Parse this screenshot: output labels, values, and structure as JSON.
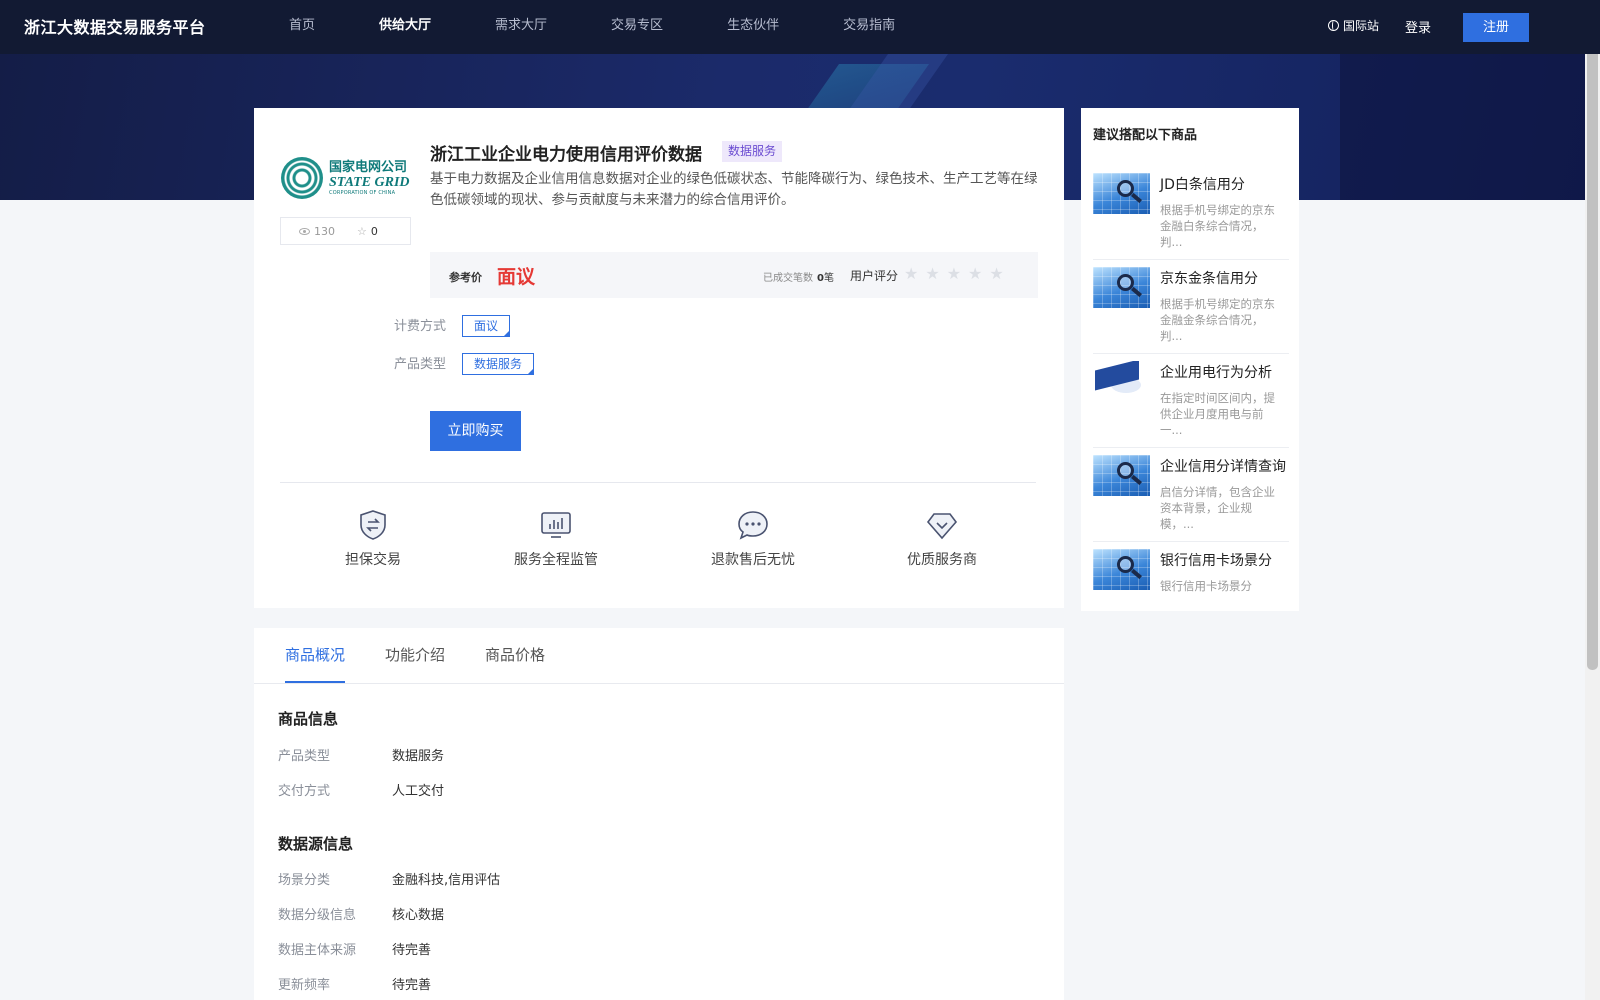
{
  "header": {
    "logo_text": "浙江大数据交易服务平台",
    "nav": [
      "首页",
      "供给大厅",
      "需求大厅",
      "交易专区",
      "生态伙伴",
      "交易指南"
    ],
    "active_nav_index": 1,
    "intl_label": "国际站",
    "login_label": "登录",
    "register_label": "注册"
  },
  "product": {
    "vendor_logo_cn": "国家电网公司",
    "vendor_logo_en": "STATE GRID",
    "vendor_logo_en_sub": "CORPORATION OF CHINA",
    "views": "130",
    "favorites": "0",
    "title": "浙江工业企业电力使用信用评价数据",
    "badge": "数据服务",
    "description": "基于电力数据及企业信用信息数据对企业的绿色低碳状态、节能降碳行为、绿色技术、生产工艺等在绿色低碳领域的现状、参与贡献度与未来潜力的综合信用评价。",
    "price_label": "参考价",
    "price_value": "面议",
    "deals_label": "已成交笔数",
    "deals_value": "0",
    "deals_unit": "笔",
    "rating_label": "用户评分",
    "rating_stars": "★★★★★",
    "rating_value": 0,
    "billing_label": "计费方式",
    "billing_value": "面议",
    "type_label": "产品类型",
    "type_value": "数据服务",
    "buy_label": "立即购买"
  },
  "guarantees": [
    {
      "label": "担保交易",
      "icon": "shield-exchange-icon"
    },
    {
      "label": "服务全程监管",
      "icon": "monitor-chart-icon"
    },
    {
      "label": "退款售后无忧",
      "icon": "chat-bubble-icon"
    },
    {
      "label": "优质服务商",
      "icon": "diamond-icon"
    }
  ],
  "tabs": [
    "商品概况",
    "功能介绍",
    "商品价格"
  ],
  "active_tab_index": 0,
  "info_section": {
    "title": "商品信息",
    "rows": [
      {
        "key": "产品类型",
        "value": "数据服务"
      },
      {
        "key": "交付方式",
        "value": "人工交付"
      }
    ]
  },
  "source_section": {
    "title": "数据源信息",
    "rows": [
      {
        "key": "场景分类",
        "value": "金融科技,信用评估"
      },
      {
        "key": "数据分级信息",
        "value": "核心数据"
      },
      {
        "key": "数据主体来源",
        "value": "待完善"
      },
      {
        "key": "更新频率",
        "value": "待完善"
      }
    ]
  },
  "sidebar": {
    "title": "建议搭配以下商品",
    "items": [
      {
        "name": "JD白条信用分",
        "desc": "根据手机号绑定的京东金融白条综合情况，判...",
        "thumb": "magnifier-chart-icon"
      },
      {
        "name": "京东金条信用分",
        "desc": "根据手机号绑定的京东金融金条综合情况，判...",
        "thumb": "magnifier-chart-icon"
      },
      {
        "name": "企业用电行为分析",
        "desc": "在指定时间区间内，提供企业月度用电与前一...",
        "thumb": "graduation-cap-icon"
      },
      {
        "name": "企业信用分详情查询",
        "desc": "启信分详情，包含企业资本背景，企业规模，...",
        "thumb": "magnifier-chart-icon"
      },
      {
        "name": "银行信用卡场景分",
        "desc": "银行信用卡场景分",
        "thumb": "magnifier-chart-icon"
      }
    ]
  },
  "colors": {
    "primary": "#2f6fe0",
    "price_red": "#e53935",
    "header_bg": "#121a33"
  }
}
